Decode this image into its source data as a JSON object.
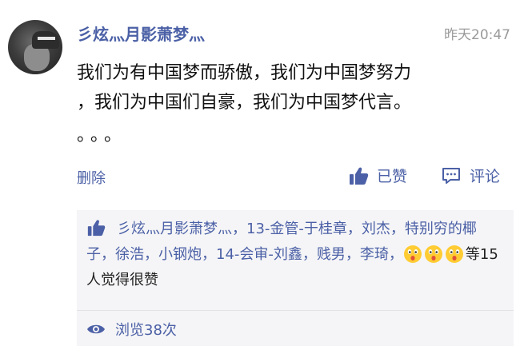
{
  "post": {
    "username": "彡炫灬月影萧梦灬",
    "timestamp": "昨天20:47",
    "content_lines": [
      "我们为有中国梦而骄傲，我们为中国梦努力",
      "，我们为中国们自豪，我们为中国梦代言。",
      "。。。"
    ]
  },
  "actions": {
    "delete_label": "删除",
    "liked_label": "已赞",
    "comment_label": "评论",
    "icons": [
      "thumbs-up-icon",
      "comment-icon"
    ]
  },
  "likes": {
    "names": [
      "彡炫灬月影萧梦灬",
      "13-金管-于桂章",
      "刘杰",
      "特别穷的椰子",
      "徐浩",
      "小钢炮",
      "14-会审-刘鑫",
      "贱男",
      "李琦"
    ],
    "separator": "，",
    "summary": "等15人觉得很赞",
    "emoji_count": 3
  },
  "views": {
    "label": "浏览38次"
  },
  "colors": {
    "link": "#4b60a6",
    "timestamp": "#9a9a9a",
    "likes_bg": "#f5f5f7"
  }
}
